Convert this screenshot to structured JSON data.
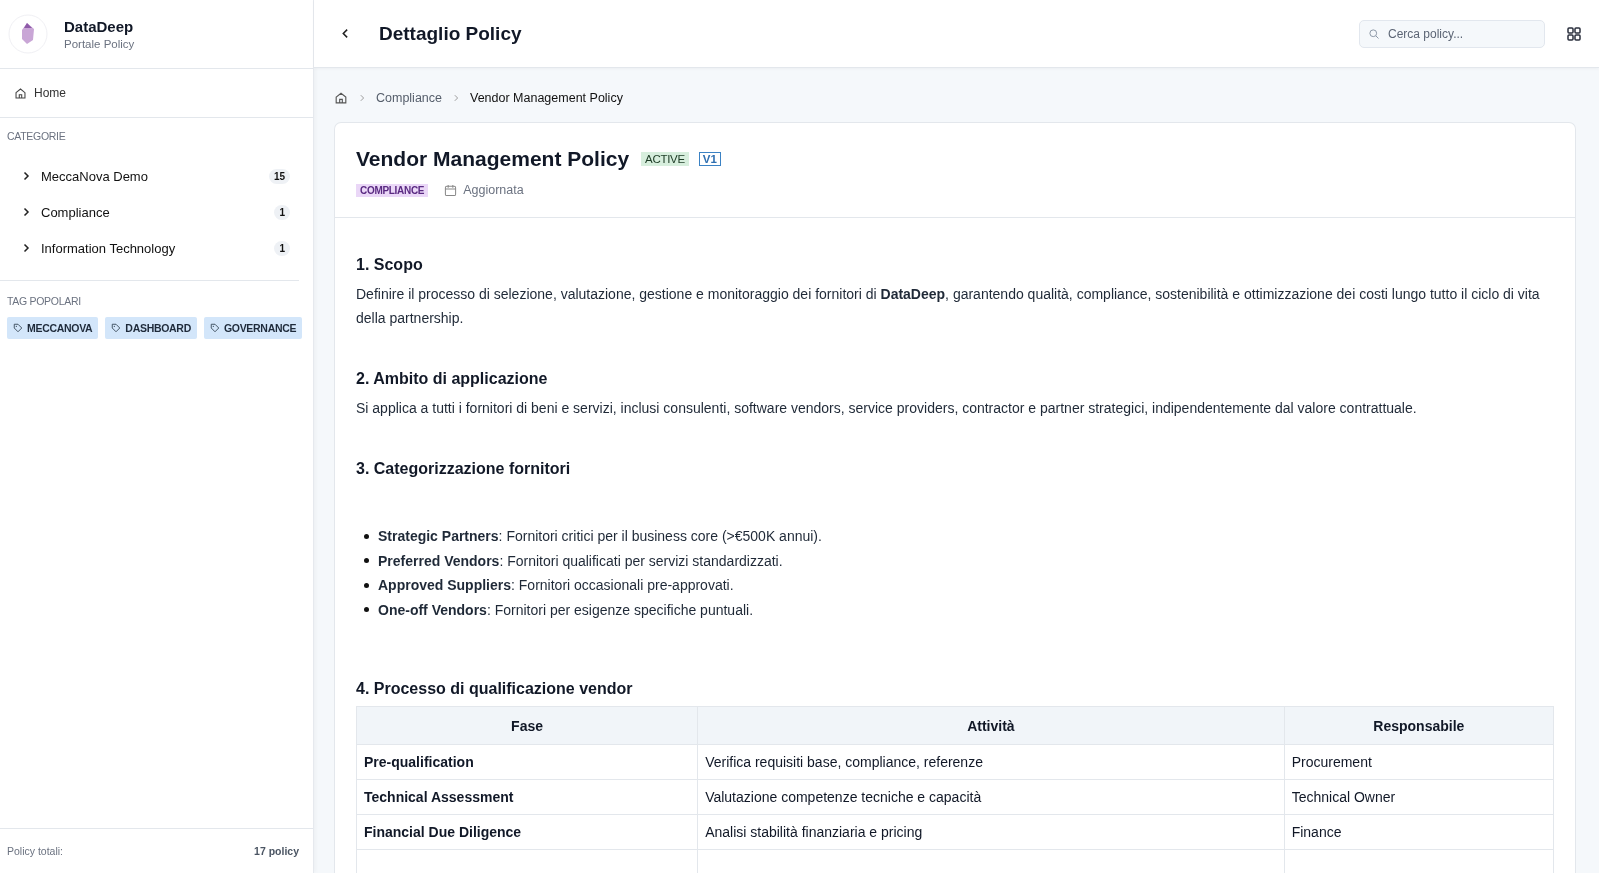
{
  "brand": {
    "name": "DataDeep",
    "subtitle": "Portale Policy"
  },
  "nav": {
    "home": "Home"
  },
  "categories": {
    "title": "CATEGORIE",
    "items": [
      {
        "label": "MeccaNova Demo",
        "count": "15",
        "expanded": false
      },
      {
        "label": "Compliance",
        "count": "1",
        "expanded": false
      },
      {
        "label": "Information Technology",
        "count": "1",
        "expanded": false
      }
    ]
  },
  "tags": {
    "title": "TAG POPOLARI",
    "items": [
      "MECCANOVA",
      "DASHBOARD",
      "GOVERNANCE"
    ]
  },
  "sidebar_footer": {
    "label": "Policy totali:",
    "value": "17 policy"
  },
  "header": {
    "title": "Dettaglio Policy",
    "search": {
      "placeholder": "Cerca policy..."
    }
  },
  "breadcrumb": [
    "Compliance",
    "Vendor Management Policy"
  ],
  "policy": {
    "title": "Vendor Management Policy",
    "status": "ACTIVE",
    "version": "V1",
    "category": "COMPLIANCE",
    "updated": "Aggiornata"
  },
  "sections": [
    {
      "kind": "text",
      "heading": "1. Scopo",
      "text": "Definire il processo di selezione, valutazione, gestione e monitoraggio dei fornitori di **DataDeep**, garantendo qualità, compliance, sostenibilità e ottimizzazione dei costi lungo tutto il ciclo di vita della partnership."
    },
    {
      "kind": "text",
      "heading": "2. Ambito di applicazione",
      "text": "Si applica a tutti i fornitori di beni e servizi, inclusi consulenti, software vendors, service providers, contractor e partner strategici, indipendentemente dal valore contrattuale."
    },
    {
      "kind": "list",
      "heading": "3. Categorizzazione fornitori",
      "items": [
        "**Strategic Partners**: Fornitori critici per il business core (>€500K annui).",
        "**Preferred Vendors**: Fornitori qualificati per servizi standardizzati.",
        "**Approved Suppliers**: Fornitori occasionali pre-approvati.",
        "**One-off Vendors**: Fornitori per esigenze specifiche puntuali."
      ]
    },
    {
      "kind": "table",
      "heading": "4. Processo di qualificazione vendor",
      "columns": [
        "Fase",
        "Attività",
        "Responsabile"
      ],
      "rows": [
        [
          "Pre-qualification",
          "Verifica requisiti base, compliance, referenze",
          "Procurement"
        ],
        [
          "Technical Assessment",
          "Valutazione competenze tecniche e capacità",
          "Technical Owner"
        ],
        [
          "Financial Due Diligence",
          "Analisi stabilità finanziaria e pricing",
          "Finance"
        ]
      ]
    }
  ]
}
